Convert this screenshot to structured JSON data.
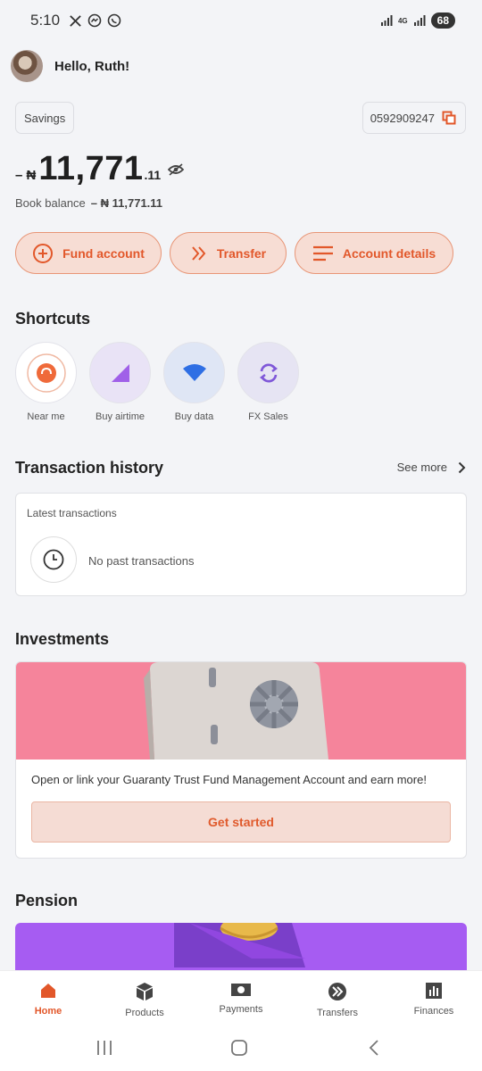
{
  "status_bar": {
    "time": "5:10",
    "left_icons": [
      "x-icon",
      "messenger-icon",
      "whatsapp-icon"
    ],
    "network_label": "4G",
    "battery": "68"
  },
  "header": {
    "greeting": "Hello, Ruth!"
  },
  "account": {
    "type": "Savings",
    "number": "0592909247",
    "balance_sign": "– ₦",
    "balance_main": "11,771",
    "balance_decimal": ".11",
    "book_balance_label": "Book balance",
    "book_balance_value": "– ₦ 11,771.11"
  },
  "actions": [
    {
      "label": "Fund account",
      "icon": "plus-circle-icon"
    },
    {
      "label": "Transfer",
      "icon": "double-chevron-icon"
    },
    {
      "label": "Account details",
      "icon": "lines-icon"
    }
  ],
  "shortcuts": {
    "title": "Shortcuts",
    "items": [
      {
        "label": "Near me",
        "icon": "location-icon",
        "bg": "#ffffff"
      },
      {
        "label": "Buy airtime",
        "icon": "signal-icon",
        "bg": "#e9e3f6"
      },
      {
        "label": "Buy data",
        "icon": "wifi-icon",
        "bg": "#dfe6f5"
      },
      {
        "label": "FX Sales",
        "icon": "exchange-icon",
        "bg": "#e6e4f3"
      }
    ]
  },
  "transactions": {
    "title": "Transaction history",
    "see_more": "See more",
    "card_title": "Latest transactions",
    "empty_text": "No past transactions"
  },
  "investments": {
    "title": "Investments",
    "description": "Open or link your Guaranty Trust Fund Management Account and earn more!",
    "button": "Get started"
  },
  "pension": {
    "title": "Pension"
  },
  "bottom_nav": [
    {
      "label": "Home",
      "icon": "home-icon",
      "active": true
    },
    {
      "label": "Products",
      "icon": "box-icon",
      "active": false
    },
    {
      "label": "Payments",
      "icon": "cash-icon",
      "active": false
    },
    {
      "label": "Transfers",
      "icon": "transfer-icon",
      "active": false
    },
    {
      "label": "Finances",
      "icon": "chart-icon",
      "active": false
    }
  ],
  "colors": {
    "accent": "#e2572a",
    "accent_soft": "#f7ddd4",
    "background": "#f3f4f7",
    "investment_banner": "#f5849b",
    "pension_banner": "#a65cf2"
  }
}
